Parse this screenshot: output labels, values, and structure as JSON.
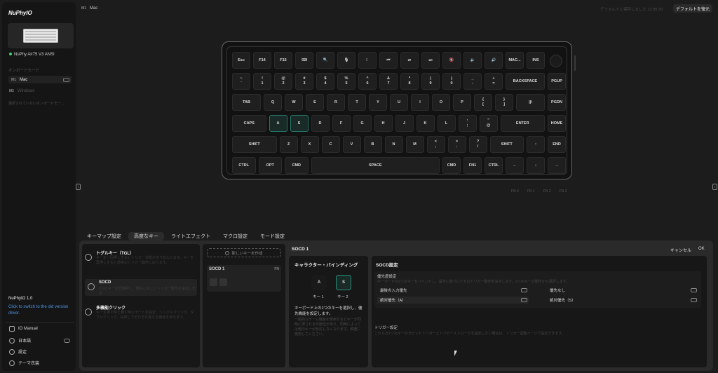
{
  "app": {
    "logo": "NuPhyIO"
  },
  "device": {
    "name": "NuPhy Air75 V3 ANSI"
  },
  "sidebar": {
    "section": "オンボードモード",
    "modes": [
      {
        "badge": "M1",
        "label": "Mac"
      },
      {
        "badge": "M2",
        "label": "Windows"
      }
    ],
    "empty_note": "選択されていないオンボードモー...",
    "version": "NuPhyIO 1.0",
    "old_link": "Click to switch to the old version driver.",
    "menu": [
      {
        "icon": "io-manual-icon",
        "label": "IO Manual"
      },
      {
        "icon": "language-icon",
        "label": "日本語"
      },
      {
        "icon": "settings-icon",
        "label": "設定"
      },
      {
        "icon": "theme-icon",
        "label": "テーマ衣装"
      }
    ]
  },
  "header": {
    "mode_badge": "M1",
    "mode_name": "Mac",
    "saved_text": "デフォルトに保存しました 12:35:30",
    "restore_label": "デフォルトを復元"
  },
  "keyboard": {
    "rows": [
      [
        "Esc",
        "F14",
        "F15",
        "⌨",
        "🔍",
        "🎙",
        "☾",
        "⏮",
        "⏯",
        "⏭",
        "🔇",
        "🔉",
        "🔊",
        "MAC...",
        "INS"
      ],
      [
        "~|`",
        "!|1",
        "@|2",
        "#|3",
        "$|4",
        "%|5",
        "^|6",
        "&|7",
        "*|8",
        "(|9",
        ")|0",
        "_|-",
        "+|=",
        "BACKSPACE",
        "PGUP"
      ],
      [
        "TAB",
        "Q",
        "W",
        "E",
        "R",
        "T",
        "Y",
        "U",
        "I",
        "O",
        "P",
        "{|[",
        "}|]",
        "||\\",
        "PGDN"
      ],
      [
        "CAPS",
        "A",
        "S",
        "D",
        "F",
        "G",
        "H",
        "J",
        "K",
        "L",
        ":|;",
        "\"|@",
        "ENTER",
        "HOME"
      ],
      [
        "SHIFT",
        "Z",
        "X",
        "C",
        "V",
        "B",
        "N",
        "M",
        "<|,",
        ">|.",
        "?|/",
        "SHIFT",
        "↑",
        "END"
      ],
      [
        "CTRL",
        "OPT",
        "CMD",
        "SPACE",
        "CMD",
        "FN1",
        "CTRL",
        "←",
        "↓",
        "→"
      ]
    ],
    "fn_layers": [
      "FN 0",
      "FN 1",
      "FN 2",
      "FN 3"
    ]
  },
  "tabs": [
    "キーマップ設定",
    "高度なキー",
    "ライトエフェクト",
    "マクロ設定",
    "モード設定"
  ],
  "advanced": [
    {
      "icon": "toggle-key-icon",
      "title": "トグルキー（TGL）",
      "desc": "キーを一回押しするとトリガー状態が切り替わります。キーを再押しすると通常のトリガー動作に戻ります。"
    },
    {
      "icon": "socd-icon",
      "title": "SOCD",
      "desc": "2つのキーを同時押し、優先に応じてトリガー動作を設定します。"
    },
    {
      "icon": "multi-click-icon",
      "title": "多機能クリック",
      "desc": "キーを押す時と離す時のモードを設定：シングルクリック、ダブルクリック、長押しでそれぞれ異なる機能を持ちます。"
    }
  ],
  "keylist": {
    "new_key": "新しいキーを作成",
    "item_title": "SOCD 1",
    "item_layer": "FN"
  },
  "panel": {
    "title": "SOCD 1",
    "cancel": "キャンセル",
    "ok": "OK",
    "binding_title": "キャラクター・バインディング",
    "key1": "A",
    "key2": "S",
    "key1_label": "キー 1",
    "key2_label": "キー 2",
    "binding_desc": "キーボード上の2つのキーを選択し、優先機能を設定します。",
    "binding_note": "一般的なゲーム機能を使用するとキーが同時に押される可能性があり、同時によっては他のキーが反応しなくなります。慎重に使用してください。",
    "socd_title": "SOCD設定",
    "priority_title": "優先度設定",
    "priority_desc": "キーボードの2つのキーをバインドし、設定に基づいてそのトリガー動作を決定します。2つのキーの動作から選択します。",
    "options": [
      "最後の入力優先",
      "優先なし",
      "絶対優先（A）",
      "絶対優先（S）"
    ],
    "trigger_title": "トリガー設定",
    "trigger_desc": "これらの2つのキーのラピッドトリガーとトリガーストロークを設定したい場合は、トリガー調整ページで設定できます。"
  }
}
